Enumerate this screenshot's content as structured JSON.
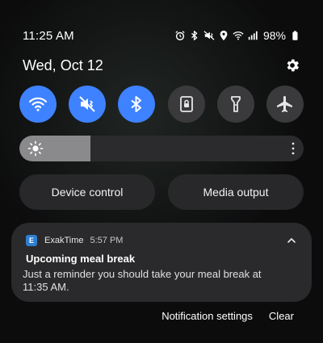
{
  "status_bar": {
    "time": "11:25 AM",
    "battery_percent": "98%",
    "icons": [
      "alarm-icon",
      "bluetooth-icon",
      "mute-icon",
      "location-icon",
      "wifi-icon",
      "signal-icon",
      "battery-icon"
    ]
  },
  "header": {
    "date": "Wed, Oct 12",
    "settings_icon": "gear-icon"
  },
  "quick_settings": {
    "tiles": [
      {
        "name": "wifi",
        "icon": "wifi-icon",
        "state": "on"
      },
      {
        "name": "sound",
        "icon": "mute-icon",
        "state": "on"
      },
      {
        "name": "bluetooth",
        "icon": "bluetooth-icon",
        "state": "on"
      },
      {
        "name": "screen-lock",
        "icon": "lock-screen-icon",
        "state": "off"
      },
      {
        "name": "flashlight",
        "icon": "flashlight-icon",
        "state": "off"
      },
      {
        "name": "airplane",
        "icon": "airplane-icon",
        "state": "off"
      }
    ]
  },
  "brightness": {
    "level": 0.25,
    "icon": "sun-icon"
  },
  "pills": {
    "device_control": "Device control",
    "media_output": "Media output"
  },
  "notification": {
    "app_icon_letter": "E",
    "app_name": "ExakTime",
    "time": "5:57 PM",
    "title": "Upcoming meal break",
    "body": "Just a reminder you should take your meal break at 11:35 AM."
  },
  "actions": {
    "settings": "Notification settings",
    "clear": "Clear"
  },
  "colors": {
    "accent": "#3e82ff",
    "tile_off": "#3a3a3c",
    "card": "#2a2a2c",
    "background": "#0c0c0d"
  }
}
